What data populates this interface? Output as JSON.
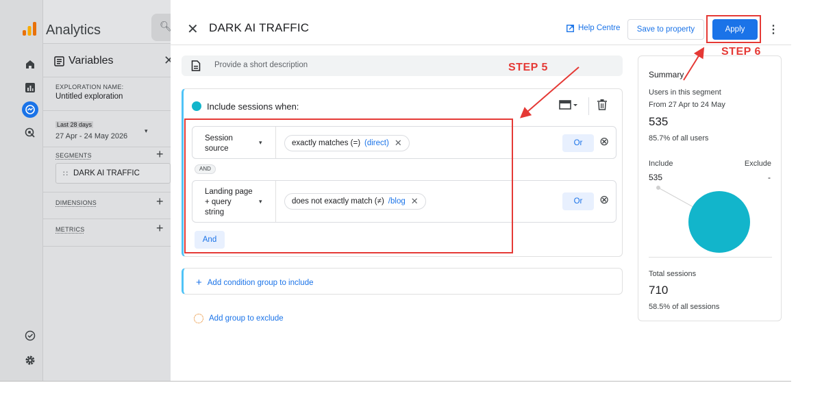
{
  "app": {
    "title": "Analytics"
  },
  "rail": {
    "icons": [
      "home-icon",
      "reports-icon",
      "explore-icon",
      "advertising-icon",
      "insights-icon",
      "settings-icon"
    ]
  },
  "variables": {
    "header": "Variables",
    "exploration_label": "EXPLORATION NAME:",
    "exploration_value": "Untitled exploration",
    "date_label": "Last 28 days",
    "date_value": "27 Apr - 24 May 2026",
    "segments_label": "SEGMENTS",
    "segment_chip": "DARK AI TRAFFIC",
    "dimensions_label": "DIMENSIONS",
    "metrics_label": "METRICS"
  },
  "segment_editor": {
    "name": "DARK AI TRAFFIC",
    "help": "Help Centre",
    "save": "Save to property",
    "apply": "Apply",
    "description_placeholder": "Provide a short description",
    "include_title": "Include sessions when:",
    "conditions": [
      {
        "dimension": [
          "Session",
          "source"
        ],
        "operator": "exactly matches (=)",
        "value": "(direct)",
        "or": "Or"
      },
      {
        "dimension": [
          "Landing page",
          "+ query",
          "string"
        ],
        "operator": "does not exactly match (≠)",
        "value": "/blog",
        "or": "Or"
      }
    ],
    "and_badge": "AND",
    "and_button": "And",
    "add_include_group": "Add condition group to include",
    "add_exclude_group": "Add group to exclude"
  },
  "summary": {
    "title": "Summary",
    "users_label": "Users in this segment",
    "range": "From 27 Apr to 24 May",
    "users": "535",
    "users_pct": "85.7% of all users",
    "include_label": "Include",
    "exclude_label": "Exclude",
    "include_value": "535",
    "exclude_value": "-",
    "sessions_label": "Total sessions",
    "sessions": "710",
    "sessions_pct": "58.5% of all sessions",
    "pie_color": "#12b5cb"
  },
  "annotations": {
    "step5": "STEP 5",
    "step6": "STEP 6",
    "color": "#e53935"
  }
}
